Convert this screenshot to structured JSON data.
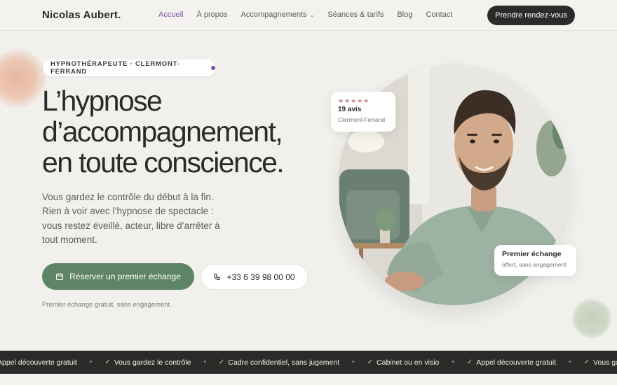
{
  "brand": "Nicolas Aubert.",
  "nav": {
    "items": [
      {
        "label": "Accueil",
        "active": true
      },
      {
        "label": "À propos"
      },
      {
        "label": "Accompagnements",
        "dropdown": true
      },
      {
        "label": "Séances & tarifs"
      },
      {
        "label": "Blog"
      },
      {
        "label": "Contact"
      }
    ],
    "cta": "Prendre rendez-vous"
  },
  "hero": {
    "badge": "HYPNOTHÉRAPEUTE · CLERMONT-FERRAND",
    "title_lines": [
      "L’hypnose",
      "d’accompagnement,",
      "en toute conscience."
    ],
    "lede": "Vous gardez le contrôle du début à la fin. Rien à voir avec l’hypnose de spectacle : vous restez éveillé, acteur, libre d’arrêter à tout moment.",
    "primary_button": "Réserver un premier échange",
    "phone_button": "+33 6 39 98 00 00",
    "note": "Premier échange gratuit, sans engagement."
  },
  "reviews_card": {
    "stars": "★★★★★",
    "count": "19 avis",
    "city": "Clermont-Ferrand"
  },
  "first_card": {
    "title": "Premier échange",
    "subtitle": "offert, sans engagement"
  },
  "ticker": {
    "items": [
      {
        "label": "Appel découverte gratuit",
        "check": false
      },
      {
        "label": "Vous gardez le contrôle",
        "check": true
      },
      {
        "label": "Cadre confidentiel, sans jugement",
        "check": true
      },
      {
        "label": "Cabinet ou en visio",
        "check": true
      },
      {
        "label": "Appel découverte gratuit",
        "check": true
      },
      {
        "label": "Vous gardez le contrôle",
        "check": true
      }
    ]
  },
  "colors": {
    "accent_purple": "#7b4fa8",
    "primary_green": "#5e8466",
    "dark": "#2b2b29",
    "background": "#f1f0ec"
  }
}
